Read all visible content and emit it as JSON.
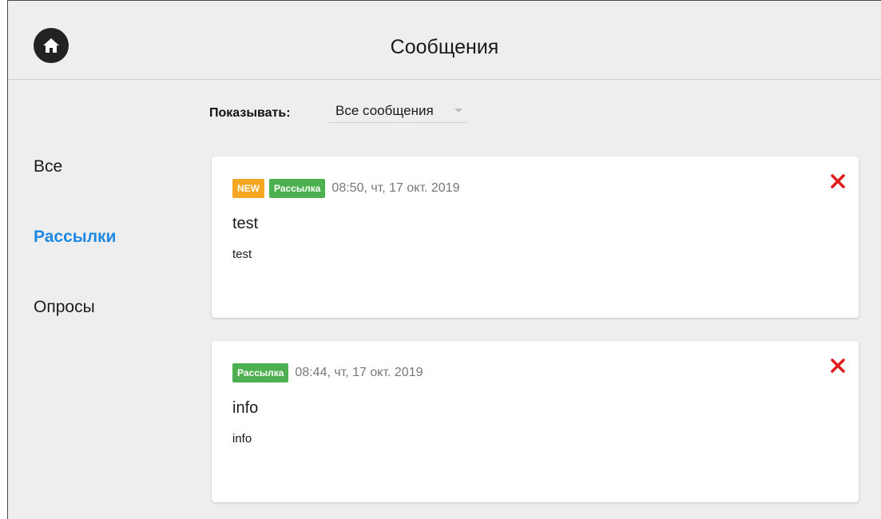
{
  "header": {
    "title": "Сообщения",
    "home_icon": "home-icon"
  },
  "filter": {
    "label": "Показывать:",
    "selected": "Все сообщения"
  },
  "sidebar": {
    "items": [
      {
        "label": "Все",
        "active": false
      },
      {
        "label": "Рассылки",
        "active": true
      },
      {
        "label": "Опросы",
        "active": false
      }
    ]
  },
  "messages": [
    {
      "new_badge": "NEW",
      "type_badge": "Рассылка",
      "timestamp": "08:50, чт, 17 окт. 2019",
      "title": "test",
      "body": "test"
    },
    {
      "type_badge": "Рассылка",
      "timestamp": "08:44, чт, 17 окт. 2019",
      "title": "info",
      "body": "info"
    }
  ],
  "colors": {
    "accent": "#1e88e5",
    "new_badge": "#f5a623",
    "type_badge": "#4caf50",
    "close": "#e01b1b"
  }
}
